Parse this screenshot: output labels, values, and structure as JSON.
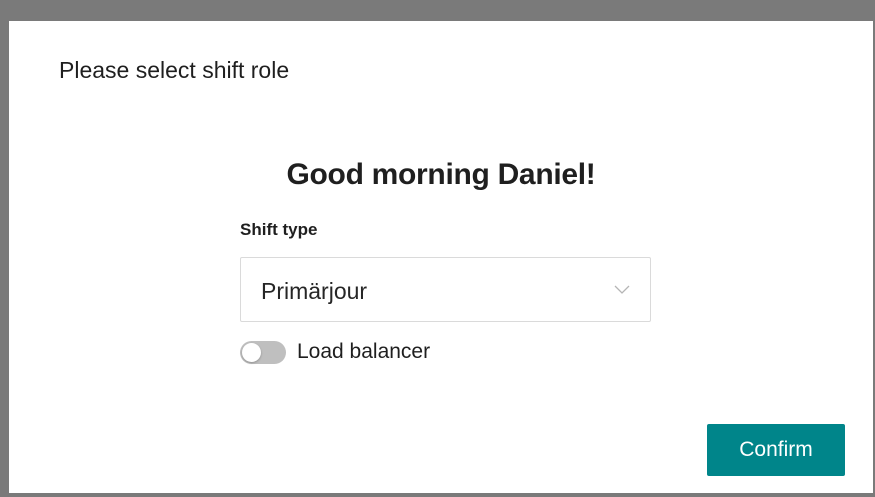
{
  "dialog": {
    "title": "Please select shift role",
    "greeting": "Good morning Daniel!"
  },
  "shift_type": {
    "label": "Shift type",
    "selected": "Primärjour",
    "chevron_icon": "chevron-down-icon"
  },
  "load_balancer": {
    "label": "Load balancer",
    "enabled": false
  },
  "actions": {
    "confirm_label": "Confirm"
  },
  "colors": {
    "accent": "#00858a",
    "toggle_off": "#bfbfbf",
    "backdrop": "#7a7a7a"
  }
}
